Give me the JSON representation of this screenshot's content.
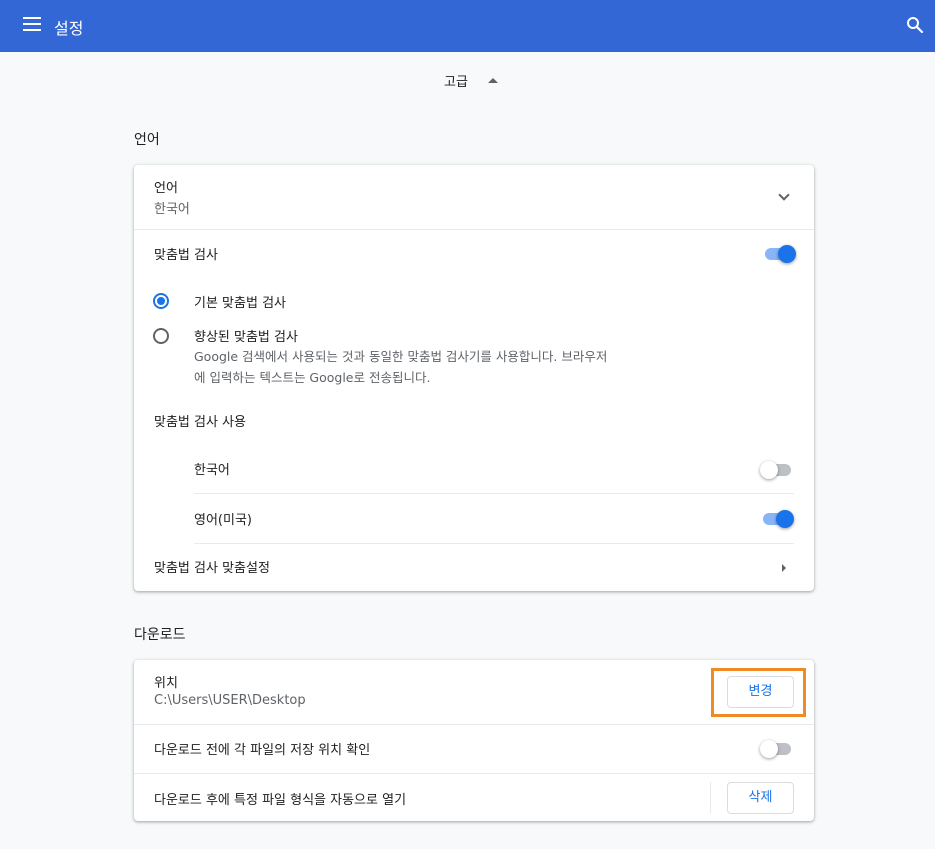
{
  "header": {
    "title": "설정",
    "menu_icon": "hamburger-menu-icon",
    "search_icon": "search-icon"
  },
  "advanced": {
    "label": "고급"
  },
  "language_section": {
    "title": "언어",
    "language_row": {
      "label": "언어",
      "value": "한국어"
    },
    "spellcheck": {
      "label": "맞춤법 검사",
      "enabled": true
    },
    "basic_spellcheck": {
      "label": "기본 맞춤법 검사",
      "selected": true
    },
    "enhanced_spellcheck": {
      "label": "향상된 맞춤법 검사",
      "description_line1": "Google 검색에서 사용되는 것과 동일한 맞춤법 검사기를 사용합니다. 브라우저",
      "description_line2": "에 입력하는 텍스트는 Google로 전송됩니다.",
      "selected": false
    },
    "use_spellcheck_for": {
      "label": "맞춤법 검사 사용"
    },
    "languages": [
      {
        "label": "한국어",
        "enabled": false
      },
      {
        "label": "영어(미국)",
        "enabled": true
      }
    ],
    "customize": {
      "label": "맞춤법 검사 맞춤설정"
    }
  },
  "downloads_section": {
    "title": "다운로드",
    "location": {
      "label": "위치",
      "path": "C:\\Users\\USER\\Desktop",
      "button": "변경"
    },
    "ask_location": {
      "label": "다운로드 전에 각 파일의 저장 위치 확인",
      "enabled": false
    },
    "auto_open": {
      "label": "다운로드 후에 특정 파일 형식을 자동으로 열기",
      "button": "삭제"
    }
  },
  "colors": {
    "header": "#3367d6",
    "accent": "#1a73e8",
    "highlight": "#f08a24"
  }
}
